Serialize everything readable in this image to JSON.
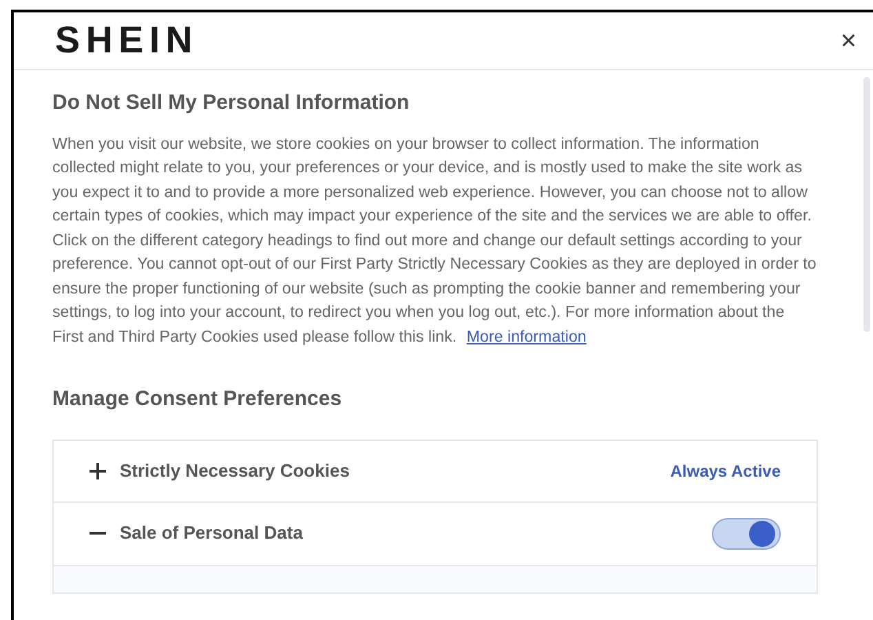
{
  "header": {
    "logo": "SHEIN",
    "close": "×"
  },
  "intro": {
    "title": "Do Not Sell My Personal Information",
    "text": "When you visit our website, we store cookies on your browser to collect information. The information collected might relate to you, your preferences or your device, and is mostly used to make the site work as you expect it to and to provide a more personalized web experience. However, you can choose not to allow certain types of cookies, which may impact your experience of the site and the services we are able to offer. Click on the different category headings to find out more and change our default settings according to your preference. You cannot opt-out of our First Party Strictly Necessary Cookies as they are deployed in order to ensure the proper functioning of our website (such as prompting the cookie banner and remembering your settings, to log into your account, to redirect you when you log out, etc.). For more information about the First and Third Party Cookies used please follow this link.",
    "link": "More information"
  },
  "preferences": {
    "title": "Manage Consent Preferences",
    "categories": [
      {
        "kind": "always_active",
        "label": "Strictly Necessary Cookies",
        "expanded": false,
        "status": "Always Active"
      },
      {
        "kind": "toggle",
        "label": "Sale of Personal Data",
        "expanded": true,
        "on": true
      }
    ]
  }
}
